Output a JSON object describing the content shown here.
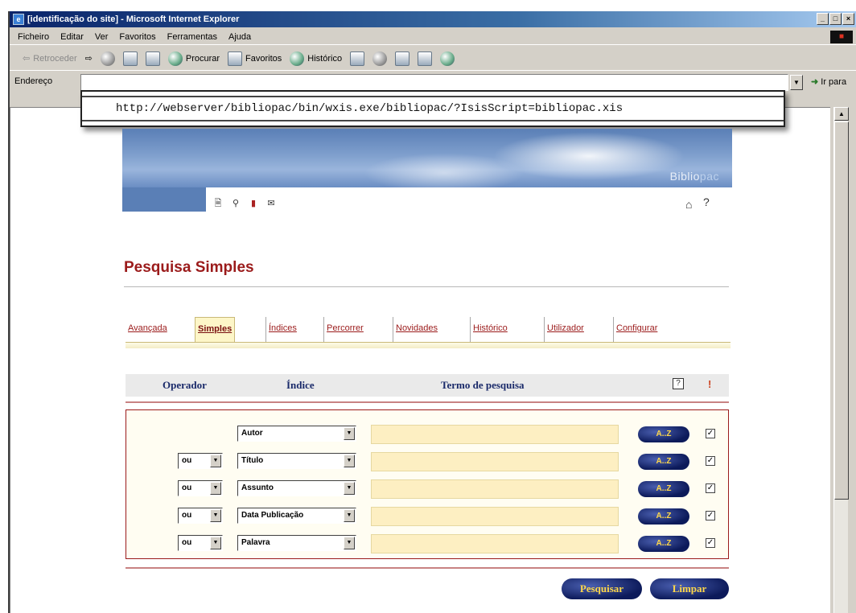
{
  "window": {
    "title": "[identificação do site] - Microsoft Internet Explorer",
    "buttons": [
      "_",
      "□",
      "×"
    ]
  },
  "menu": [
    "Ficheiro",
    "Editar",
    "Ver",
    "Favoritos",
    "Ferramentas",
    "Ajuda"
  ],
  "toolbar": {
    "back": "Retroceder",
    "search": "Procurar",
    "favorites": "Favoritos",
    "history": "Histórico"
  },
  "address": {
    "label": "Endereço",
    "go": "Ir para",
    "url": "http://webserver/bibliopac/bin/wxis.exe/bibliopac/?IsisScript=bibliopac.xis"
  },
  "banner": {
    "brand_main": "Biblio",
    "brand_pac": "pac"
  },
  "page": {
    "title": "Pesquisa Simples"
  },
  "tabs": [
    "Avançada",
    "Simples",
    "Índices",
    "Percorrer",
    "Novidades",
    "Histórico",
    "Utilizador",
    "Configurar"
  ],
  "active_tab": "Simples",
  "columns": {
    "operator": "Operador",
    "index": "Índice",
    "term": "Termo de pesquisa"
  },
  "rows": [
    {
      "operator": "",
      "index": "Autor",
      "term": "",
      "button": "A..Z",
      "checked": true
    },
    {
      "operator": "ou",
      "index": "Título",
      "term": "",
      "button": "A..Z",
      "checked": true
    },
    {
      "operator": "ou",
      "index": "Assunto",
      "term": "",
      "button": "A..Z",
      "checked": true
    },
    {
      "operator": "ou",
      "index": "Data Publicação",
      "term": "",
      "button": "A..Z",
      "checked": true
    },
    {
      "operator": "ou",
      "index": "Palavra",
      "term": "",
      "button": "A..Z",
      "checked": true
    }
  ],
  "actions": {
    "search": "Pesquisar",
    "clear": "Limpar"
  },
  "colors": {
    "accent_red": "#9b1b1b",
    "button_navy": "#0c1a5a",
    "button_text": "#ffd84a",
    "input_bg": "#fdefc2"
  }
}
